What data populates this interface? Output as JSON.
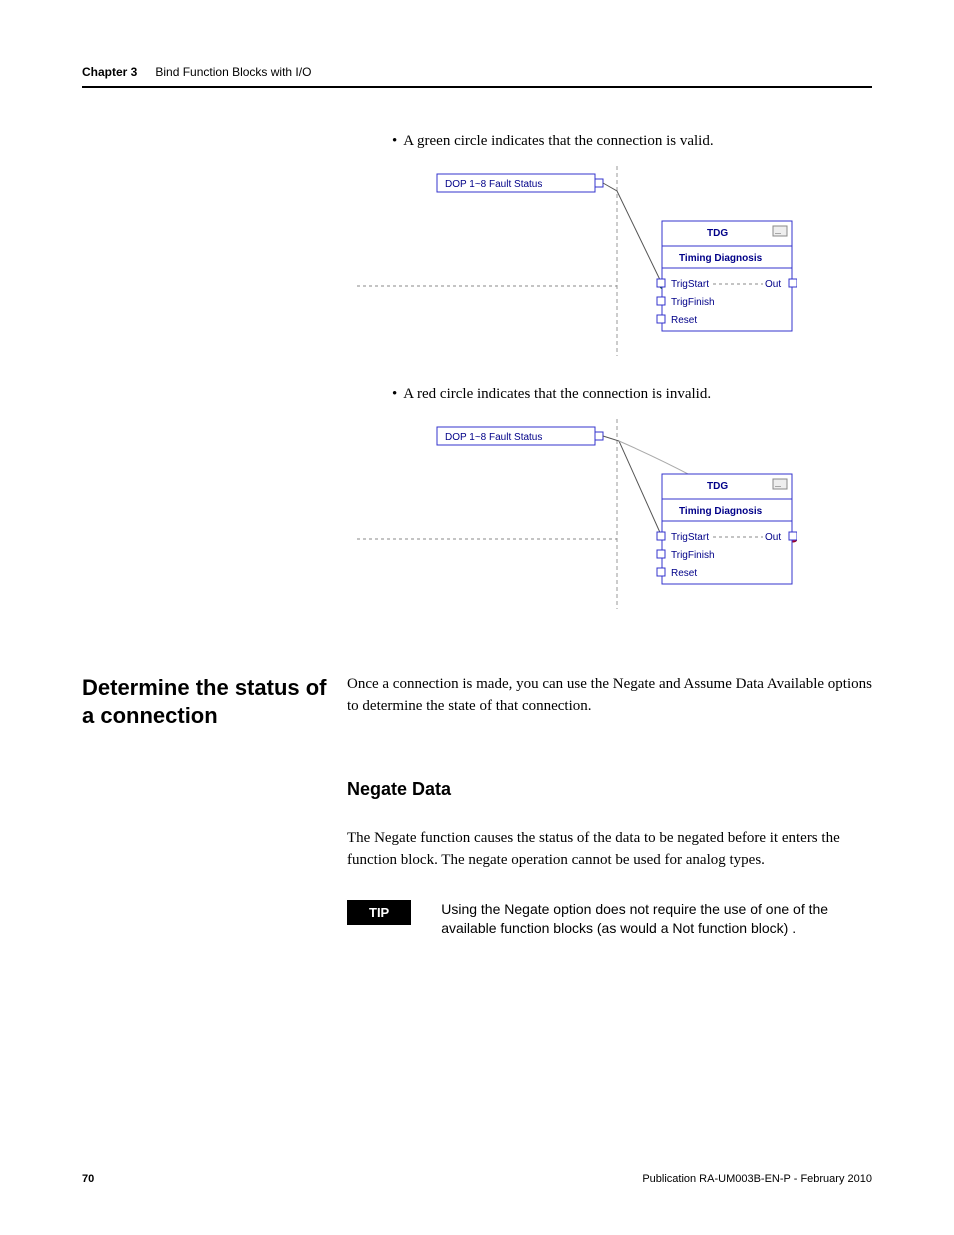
{
  "header": {
    "chapter_label": "Chapter 3",
    "chapter_title": "Bind Function Blocks with I/O"
  },
  "bullets": {
    "green": "A green circle indicates that the connection is valid.",
    "red": "A red circle indicates that the connection is invalid."
  },
  "diagram1": {
    "input_label": "DOP 1~8 Fault Status",
    "block_title": "TDG",
    "block_subtitle": "Timing Diagnosis",
    "ports": {
      "trig_start": "TrigStart",
      "trig_finish": "TrigFinish",
      "reset": "Reset",
      "out": "Out"
    }
  },
  "diagram2": {
    "input_label": "DOP 1~8 Fault Status",
    "block_title": "TDG",
    "block_subtitle": "Timing Diagnosis",
    "ports": {
      "trig_start": "TrigStart",
      "trig_finish": "TrigFinish",
      "reset": "Reset",
      "out": "Out"
    }
  },
  "section": {
    "heading": "Determine the status of a connection",
    "body": "Once a connection is made, you can use the Negate and Assume Data Available options to determine the state of that connection."
  },
  "subsection": {
    "heading": "Negate Data",
    "body": "The Negate function causes the status of the data to be negated before it enters the function block. The negate operation cannot be used for analog types."
  },
  "tip": {
    "label": "TIP",
    "text": "Using the Negate option does not require the use of one of the available function blocks (as would a Not function block) ."
  },
  "footer": {
    "page": "70",
    "pub": "Publication RA-UM003B-EN-P - February 2010"
  }
}
